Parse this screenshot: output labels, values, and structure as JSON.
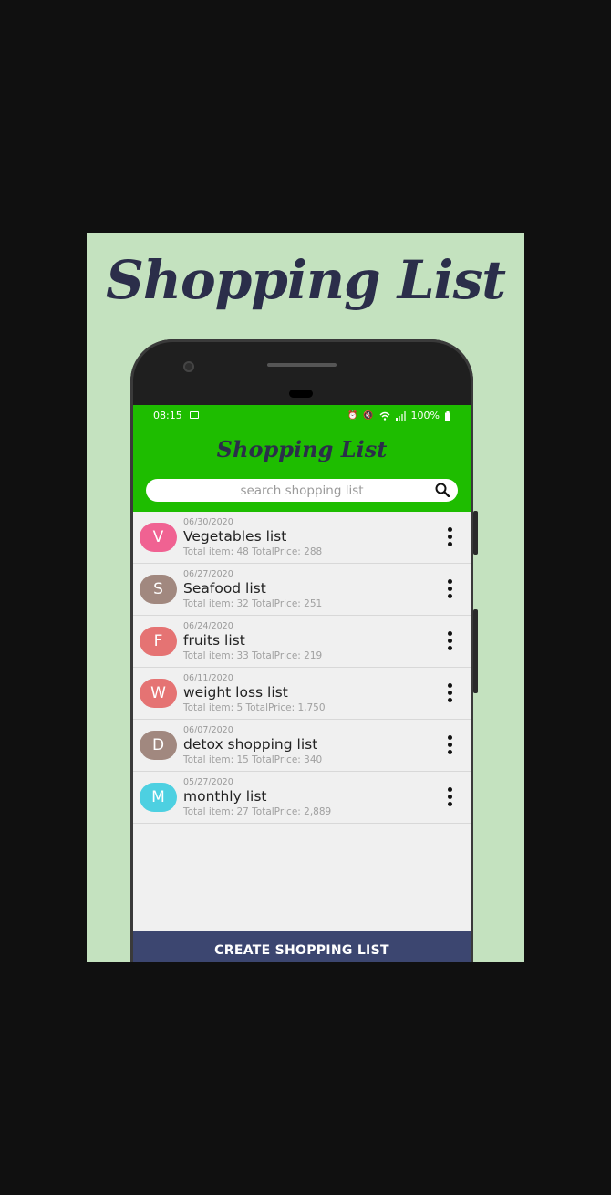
{
  "promo": {
    "title": "Shopping List"
  },
  "status_bar": {
    "time": "08:15",
    "battery": "100%"
  },
  "app": {
    "title": "Shopping List",
    "search_placeholder": "search shopping list"
  },
  "lists": [
    {
      "initial": "V",
      "color": "#f06292",
      "date": "06/30/2020",
      "name": "Vegetables list",
      "meta": "Total item: 48  TotalPrice: 288"
    },
    {
      "initial": "S",
      "color": "#a1887f",
      "date": "06/27/2020",
      "name": "Seafood list",
      "meta": "Total item: 32  TotalPrice: 251"
    },
    {
      "initial": "F",
      "color": "#e57373",
      "date": "06/24/2020",
      "name": "fruits list",
      "meta": "Total item: 33  TotalPrice: 219"
    },
    {
      "initial": "W",
      "color": "#e57373",
      "date": "06/11/2020",
      "name": "weight loss list",
      "meta": "Total item: 5  TotalPrice: 1,750"
    },
    {
      "initial": "D",
      "color": "#a1887f",
      "date": "06/07/2020",
      "name": "detox shopping list",
      "meta": "Total item: 15  TotalPrice: 340"
    },
    {
      "initial": "M",
      "color": "#4dd0e1",
      "date": "05/27/2020",
      "name": "monthly list",
      "meta": "Total item: 27  TotalPrice: 2,889"
    }
  ],
  "actions": {
    "create": "CREATE SHOPPING LIST"
  },
  "colors": {
    "appbar": "#1ebd00",
    "background": "#c4e2bf",
    "button": "#3c4670",
    "title": "#2b2e4a"
  }
}
